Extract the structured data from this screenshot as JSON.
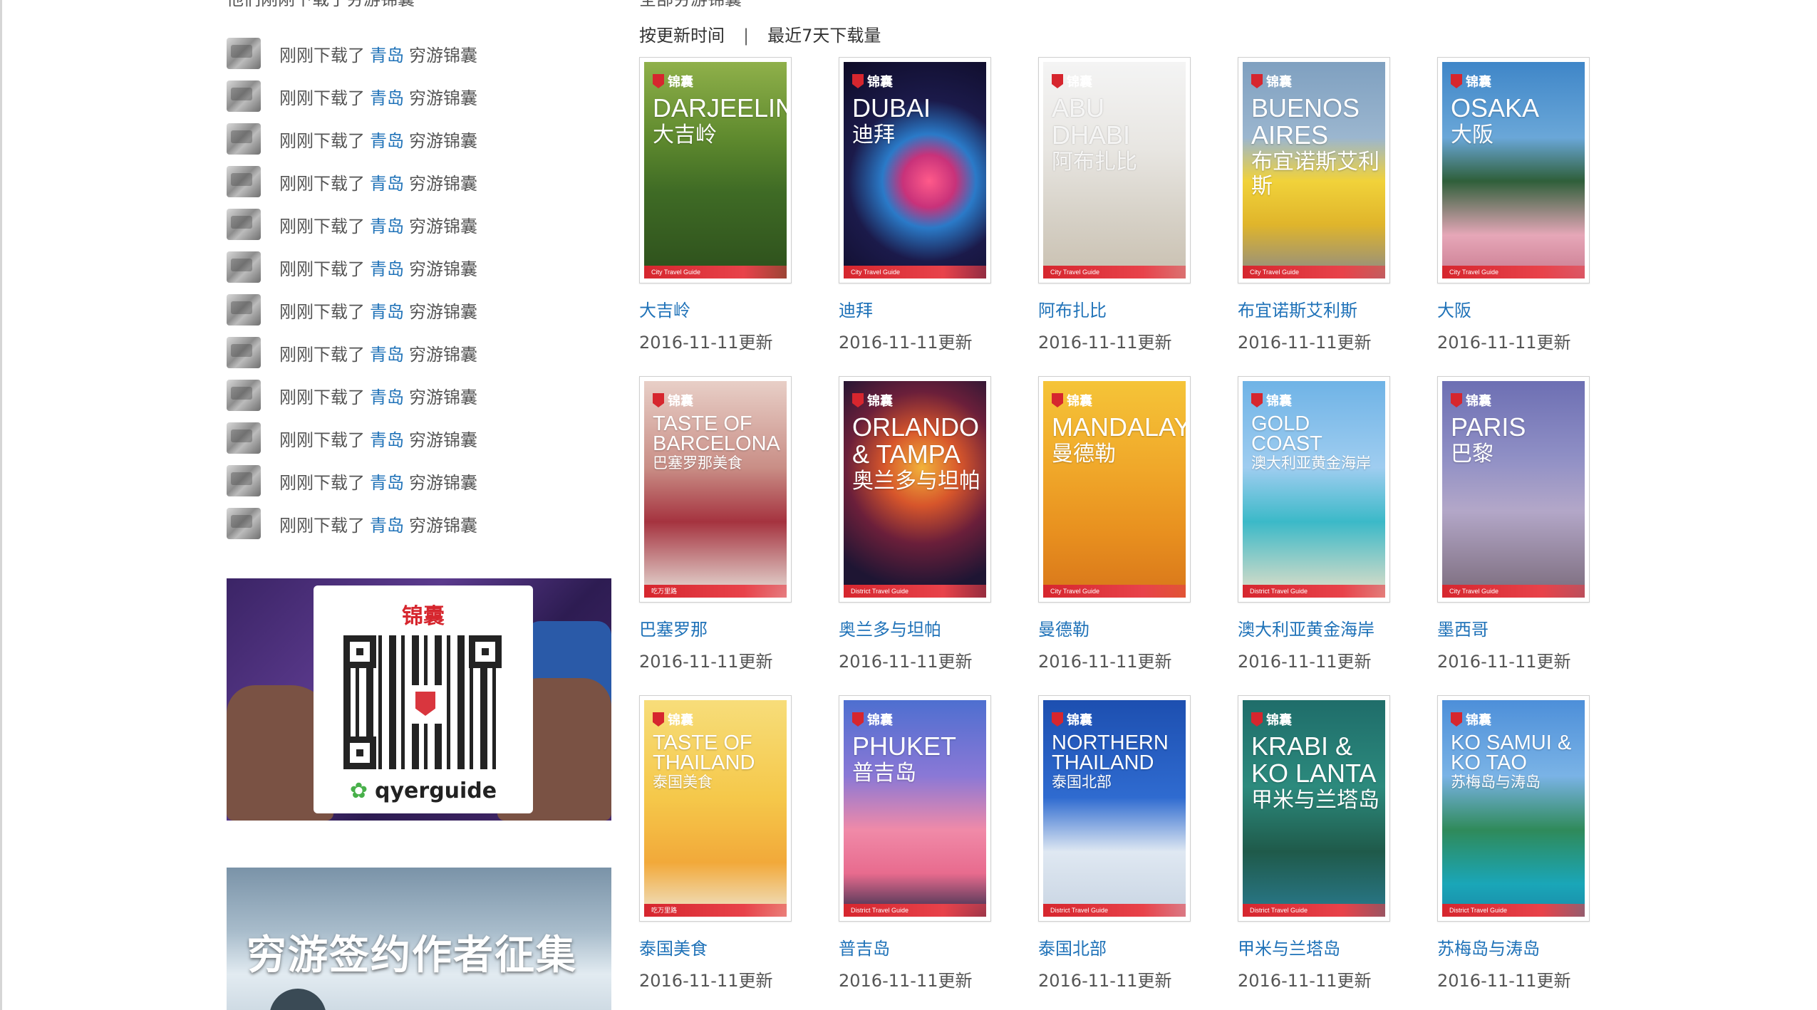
{
  "recent": {
    "heading": "他们刚刚下载了穷游锦囊",
    "items": [
      {
        "prefix": "刚刚下载了",
        "city": "青岛",
        "suffix": "穷游锦囊"
      },
      {
        "prefix": "刚刚下载了",
        "city": "青岛",
        "suffix": "穷游锦囊"
      },
      {
        "prefix": "刚刚下载了",
        "city": "青岛",
        "suffix": "穷游锦囊"
      },
      {
        "prefix": "刚刚下载了",
        "city": "青岛",
        "suffix": "穷游锦囊"
      },
      {
        "prefix": "刚刚下载了",
        "city": "青岛",
        "suffix": "穷游锦囊"
      },
      {
        "prefix": "刚刚下载了",
        "city": "青岛",
        "suffix": "穷游锦囊"
      },
      {
        "prefix": "刚刚下载了",
        "city": "青岛",
        "suffix": "穷游锦囊"
      },
      {
        "prefix": "刚刚下载了",
        "city": "青岛",
        "suffix": "穷游锦囊"
      },
      {
        "prefix": "刚刚下载了",
        "city": "青岛",
        "suffix": "穷游锦囊"
      },
      {
        "prefix": "刚刚下载了",
        "city": "青岛",
        "suffix": "穷游锦囊"
      },
      {
        "prefix": "刚刚下载了",
        "city": "青岛",
        "suffix": "穷游锦囊"
      },
      {
        "prefix": "刚刚下载了",
        "city": "青岛",
        "suffix": "穷游锦囊"
      }
    ]
  },
  "qr_banner": {
    "brand": "锦囊",
    "caption": "qyerguide"
  },
  "author_banner": {
    "title": "穷游签约作者征集"
  },
  "catalog": {
    "heading": "全部穷游锦囊",
    "sort_by_update": "按更新时间",
    "separator": "|",
    "sort_by_downloads": "最近7天下载量"
  },
  "colors": {
    "link": "#1f72b8",
    "brand_red": "#d6262e"
  },
  "guides": [
    {
      "name": "大吉岭",
      "date": "2016-11-11更新",
      "en": "DARJEELING",
      "zh": "大吉岭",
      "band": "City Travel Guide",
      "bg": "linear-gradient(180deg,#8fb04a 0%,#5f8a2e 35%,#3f6b25 60%,#2d4f1c 100%)",
      "small": false
    },
    {
      "name": "迪拜",
      "date": "2016-11-11更新",
      "en": "DUBAI",
      "zh": "迪拜",
      "band": "City Travel Guide",
      "bg": "radial-gradient(circle at 60% 55%,#ff5a8a 0%,#c8327a 18%,#2a7ac8 32%,#1b1a4a 55%,#0e0b26 100%)",
      "small": false
    },
    {
      "name": "阿布扎比",
      "date": "2016-11-11更新",
      "en": "ABU DHABI",
      "zh": "阿布扎比",
      "band": "City Travel Guide",
      "bg": "linear-gradient(180deg,#f4f4f4 0%,#e8e6e2 40%,#d7d2c8 70%,#c9c0b0 100%)",
      "small": false,
      "muted": true
    },
    {
      "name": "布宜诺斯艾利斯",
      "date": "2016-11-11更新",
      "en": "BUENOS AIRES",
      "zh": "布宜诺斯艾利斯",
      "band": "City Travel Guide",
      "bg": "linear-gradient(180deg,#7fa0c0 0%,#9bb6cf 35%,#f1d23a 55%,#e0b52b 75%,#8a8a8a 100%)",
      "small": false
    },
    {
      "name": "大阪",
      "date": "2016-11-11更新",
      "en": "OSAKA",
      "zh": "大阪",
      "band": "City Travel Guide",
      "bg": "linear-gradient(180deg,#3f86c8 0%,#6aa7d8 35%,#2f5f3a 55%,#e6a7b8 80%,#c97a8f 100%)",
      "small": false
    },
    {
      "name": "巴塞罗那",
      "date": "2016-11-11更新",
      "en": "TASTE OF BARCELONA",
      "zh": "巴塞罗那美食",
      "band": "吃万里路",
      "bg": "linear-gradient(180deg,#e8cfc7 0%,#c98e86 40%,#a5333f 65%,#e9e3dc 100%)",
      "small": true
    },
    {
      "name": "奥兰多与坦帕",
      "date": "2016-11-11更新",
      "en": "ORLANDO & TAMPA",
      "zh": "奥兰多与坦帕",
      "band": "District Travel Guide",
      "bg": "radial-gradient(circle at 55% 40%,#f2b23a 0%,#d7562b 25%,#6b1f3a 50%,#1e1533 80%)",
      "small": false
    },
    {
      "name": "曼德勒",
      "date": "2016-11-11更新",
      "en": "MANDALAY",
      "zh": "曼德勒",
      "band": "City Travel Guide",
      "bg": "linear-gradient(180deg,#f5c438 0%,#f0a82a 40%,#e8901f 70%,#d8761a 100%)",
      "small": false
    },
    {
      "name": "澳大利亚黄金海岸",
      "date": "2016-11-11更新",
      "en": "GOLD COAST",
      "zh": "澳大利亚黄金海岸",
      "band": "District Travel Guide",
      "bg": "linear-gradient(180deg,#6fb3e6 0%,#9fcdf0 40%,#3bb9c8 65%,#e8e0c8 100%)",
      "small": true
    },
    {
      "name": "墨西哥",
      "date": "2016-11-11更新",
      "en": "PARIS",
      "zh": "巴黎",
      "band": "City Travel Guide",
      "bg": "linear-gradient(180deg,#6d6fb3 0%,#8f8fc5 35%,#b3a7c8 60%,#7a6a7a 100%)",
      "small": false
    },
    {
      "name": "泰国美食",
      "date": "2016-11-11更新",
      "en": "TASTE OF THAILAND",
      "zh": "泰国美食",
      "band": "吃万里路",
      "bg": "linear-gradient(180deg,#f7dd7a 0%,#f5c84a 45%,#f2a93a 75%,#efe6cf 100%)",
      "small": true
    },
    {
      "name": "普吉岛",
      "date": "2016-11-11更新",
      "en": "PHUKET",
      "zh": "普吉岛",
      "band": "District Travel Guide",
      "bg": "linear-gradient(180deg,#4e6fd0 0%,#8a78d6 35%,#f08aa8 60%,#e86b8e 80%,#2b2b4a 100%)",
      "small": false
    },
    {
      "name": "泰国北部",
      "date": "2016-11-11更新",
      "en": "NORTHERN THAILAND",
      "zh": "泰国北部",
      "band": "District Travel Guide",
      "bg": "linear-gradient(180deg,#1d4fb0 0%,#2f6bd0 45%,#dfe8f2 70%,#c8d4e2 100%)",
      "small": true
    },
    {
      "name": "甲米与兰塔岛",
      "date": "2016-11-11更新",
      "en": "KRABI & KO LANTA",
      "zh": "甲米与兰塔岛",
      "band": "District Travel Guide",
      "bg": "linear-gradient(180deg,#1f6d6a 0%,#2c8a7d 40%,#1f5a4a 70%,#2a7a8f 100%)",
      "small": false
    },
    {
      "name": "苏梅岛与涛岛",
      "date": "2016-11-11更新",
      "en": "KO SAMUI & KO TAO",
      "zh": "苏梅岛与涛岛",
      "band": "District Travel Guide",
      "bg": "linear-gradient(180deg,#4d8fd9 0%,#7ab3e6 35%,#2f8a5a 60%,#1aa6b8 85%,#1b8aa8 100%)",
      "small": true
    }
  ]
}
